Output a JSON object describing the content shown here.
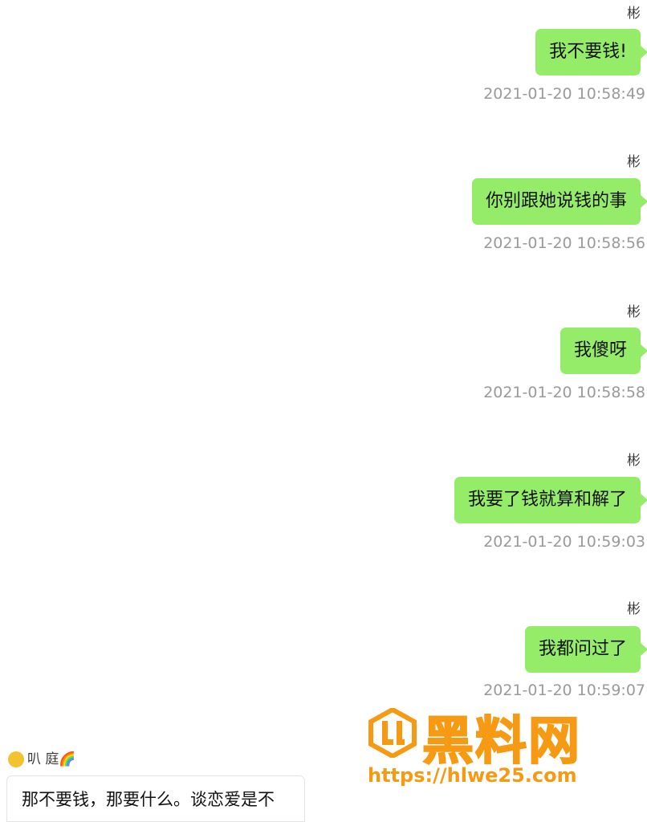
{
  "messages": [
    {
      "sender": "彬",
      "text": "我不要钱!",
      "timestamp": "2021-01-20 10:58:49"
    },
    {
      "sender": "彬",
      "text": "你别跟她说钱的事",
      "timestamp": "2021-01-20 10:58:56"
    },
    {
      "sender": "彬",
      "text": "我傻呀",
      "timestamp": "2021-01-20 10:58:58"
    },
    {
      "sender": "彬",
      "text": "我要了钱就算和解了",
      "timestamp": "2021-01-20 10:59:03"
    },
    {
      "sender": "彬",
      "text": "我都问过了",
      "timestamp": "2021-01-20 10:59:07"
    }
  ],
  "incoming": {
    "sender": "叭  庭🌈",
    "text": "那不要钱，那要什么。谈恋爱是不"
  },
  "watermark": {
    "title": "黑料网",
    "url": "https://hlwe25.com"
  },
  "colors": {
    "outgoing_bubble": "#95ec69",
    "timestamp": "#9a9a9a",
    "watermark": "#f59a12"
  }
}
